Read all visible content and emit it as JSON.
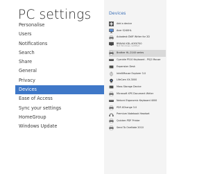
{
  "settings": {
    "title": "PC settings",
    "nav": [
      {
        "label": "Personalise"
      },
      {
        "label": "Users"
      },
      {
        "label": "Notifications"
      },
      {
        "label": "Search"
      },
      {
        "label": "Share"
      },
      {
        "label": "General"
      },
      {
        "label": "Privacy"
      },
      {
        "label": "Devices",
        "selected": true
      },
      {
        "label": "Ease of Access"
      },
      {
        "label": "Sync your settings"
      },
      {
        "label": "HomeGroup"
      },
      {
        "label": "Windows Update"
      }
    ]
  },
  "devices": {
    "title": "Devices",
    "items": [
      {
        "name": "Add a device",
        "icon": "plus-icon"
      },
      {
        "name": "Acer S240HL",
        "icon": "monitor-icon"
      },
      {
        "name": "Autodesk DWF Writer for 2D",
        "icon": "printer-icon"
      },
      {
        "name": "BRAVIA KDL-40EX700",
        "status": "Not Windows certified",
        "icon": "tv-icon"
      },
      {
        "name": "Brother HL-2140 series",
        "icon": "printer-icon",
        "selected": true
      },
      {
        "name": "Cyanide P510 Keyboard - PS/2 Mouse",
        "icon": "keyboard-icon"
      },
      {
        "name": "Expansion Desk",
        "icon": "drive-icon"
      },
      {
        "name": "IntelliMouse Explorer 3.0",
        "icon": "mouse-icon"
      },
      {
        "name": "LifeCam VX-3000",
        "icon": "webcam-icon"
      },
      {
        "name": "Mass Storage Device",
        "icon": "drive-icon"
      },
      {
        "name": "Microsoft XPS Document Writer",
        "icon": "printer-icon"
      },
      {
        "name": "Natural Ergonomic Keyboard 4000",
        "icon": "keyboard-icon"
      },
      {
        "name": "PDF-XChange 3.0",
        "icon": "printer-icon"
      },
      {
        "name": "Premium Notebook Headset",
        "icon": "headset-icon"
      },
      {
        "name": "Quicken PDF Printer",
        "icon": "printer-icon"
      },
      {
        "name": "Send To OneNote 2010",
        "icon": "printer-icon"
      }
    ]
  },
  "colors": {
    "accent": "#3f78c8",
    "section_title": "#3b6fb6",
    "right_pane_bg": "#f4f4f4",
    "selected_device_bg": "#d9d9d9"
  }
}
